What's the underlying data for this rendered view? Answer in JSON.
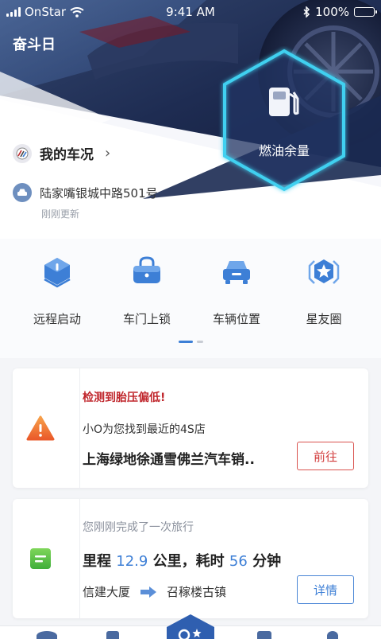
{
  "status_bar": {
    "carrier": "OnStar",
    "time": "9:41 AM",
    "battery": "100%"
  },
  "header": {
    "title": "奋斗日"
  },
  "fuel": {
    "label": "燃油余量"
  },
  "car_status": {
    "label": "我的车况",
    "chevron": "›"
  },
  "location": {
    "address": "陆家嘴银城中路501号",
    "updated": "刚刚更新"
  },
  "quick_actions": [
    {
      "label": "远程启动",
      "icon": "remote-start-icon"
    },
    {
      "label": "车门上锁",
      "icon": "door-lock-icon"
    },
    {
      "label": "车辆位置",
      "icon": "car-location-icon"
    },
    {
      "label": "星友圈",
      "icon": "star-circle-icon"
    }
  ],
  "pager": {
    "pages": 2,
    "active": 0
  },
  "alert_card": {
    "title": "检测到胎压偏低!",
    "subtitle": "小O为您找到最近的4S店",
    "shop": "上海绿地徐通雪佛兰汽车销..",
    "button": "前往",
    "icon": "warning-icon"
  },
  "trip_card": {
    "heading": "您刚刚完成了一次旅行",
    "distance_label": "里程",
    "distance": "12.9",
    "distance_unit": "公里，耗时",
    "duration": "56",
    "duration_unit": "分钟",
    "from": "信建大厦",
    "to": "召稼楼古镇",
    "button": "详情",
    "icon": "trip-note-icon"
  },
  "colors": {
    "accent_blue": "#3d7fd6",
    "alert_red": "#c0272d",
    "hex_glow": "#3fd0f0",
    "dark_navy": "#1b2a52"
  }
}
